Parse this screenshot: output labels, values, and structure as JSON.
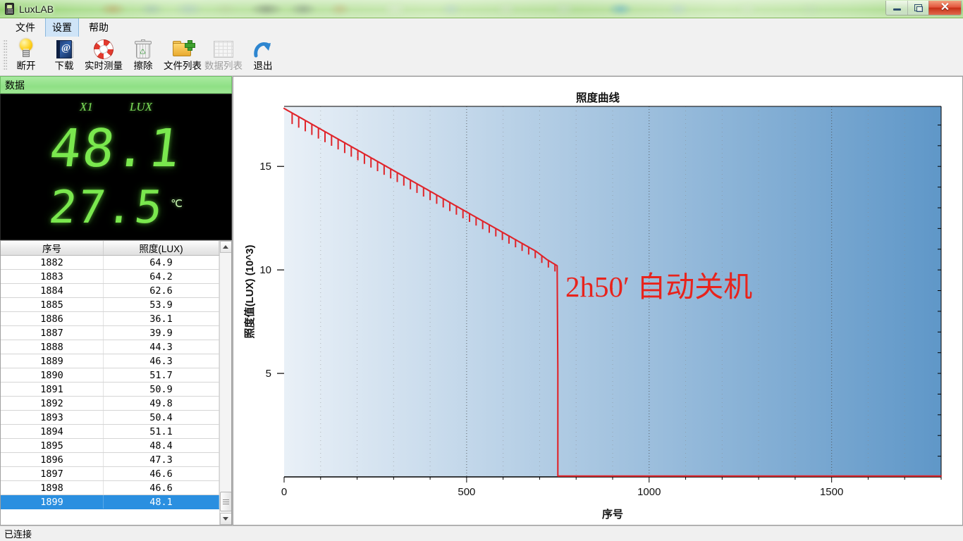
{
  "window": {
    "title": "LuxLAB",
    "app_icon": "device-icon",
    "buttons": {
      "minimize": "minimize-icon",
      "restore": "restore-icon",
      "close": "✕"
    }
  },
  "menu": {
    "items": [
      {
        "label": "文件",
        "active": false
      },
      {
        "label": "设置",
        "active": true
      },
      {
        "label": "帮助",
        "active": false
      }
    ]
  },
  "toolbar": {
    "buttons": [
      {
        "label": "断开",
        "icon": "lightbulb-icon",
        "disabled": false
      },
      {
        "label": "下载",
        "icon": "book-at-icon",
        "disabled": false
      },
      {
        "label": "实时测量",
        "icon": "lifebuoy-icon",
        "disabled": false
      },
      {
        "label": "擦除",
        "icon": "trash-icon",
        "disabled": false
      },
      {
        "label": "文件列表",
        "icon": "folder-plus-icon",
        "disabled": false
      },
      {
        "label": "数据列表",
        "icon": "table-grid-icon",
        "disabled": true
      },
      {
        "label": "退出",
        "icon": "exit-arrow-icon",
        "disabled": false
      }
    ]
  },
  "data_panel": {
    "header": "数据",
    "display": {
      "range_label": "X1",
      "unit_label": "LUX",
      "lux_value": "48.1",
      "temp_value": "27.5",
      "temp_unit": "℃"
    },
    "table": {
      "columns": [
        "序号",
        "照度(LUX)"
      ],
      "rows": [
        {
          "index": "1882",
          "lux": "64.9",
          "selected": false
        },
        {
          "index": "1883",
          "lux": "64.2",
          "selected": false
        },
        {
          "index": "1884",
          "lux": "62.6",
          "selected": false
        },
        {
          "index": "1885",
          "lux": "53.9",
          "selected": false
        },
        {
          "index": "1886",
          "lux": "36.1",
          "selected": false
        },
        {
          "index": "1887",
          "lux": "39.9",
          "selected": false
        },
        {
          "index": "1888",
          "lux": "44.3",
          "selected": false
        },
        {
          "index": "1889",
          "lux": "46.3",
          "selected": false
        },
        {
          "index": "1890",
          "lux": "51.7",
          "selected": false
        },
        {
          "index": "1891",
          "lux": "50.9",
          "selected": false
        },
        {
          "index": "1892",
          "lux": "49.8",
          "selected": false
        },
        {
          "index": "1893",
          "lux": "50.4",
          "selected": false
        },
        {
          "index": "1894",
          "lux": "51.1",
          "selected": false
        },
        {
          "index": "1895",
          "lux": "48.4",
          "selected": false
        },
        {
          "index": "1896",
          "lux": "47.3",
          "selected": false
        },
        {
          "index": "1897",
          "lux": "46.6",
          "selected": false
        },
        {
          "index": "1898",
          "lux": "46.6",
          "selected": false
        },
        {
          "index": "1899",
          "lux": "48.1",
          "selected": true
        }
      ]
    },
    "scrollbar": {
      "up": "scroll-up-icon",
      "down": "scroll-down-icon"
    }
  },
  "status": {
    "text": "已连接"
  },
  "chart_data": {
    "type": "line",
    "title": "照度曲线",
    "xlabel": "序号",
    "ylabel": "照度值(LUX) (10^3)",
    "xlim": [
      0,
      1800
    ],
    "ylim": [
      0,
      17.9
    ],
    "xticks": [
      0,
      500,
      1000,
      1500
    ],
    "xtick_labels": [
      "0",
      "500",
      "1000",
      "1500"
    ],
    "yticks": [
      5,
      10,
      15
    ],
    "ytick_labels": [
      "5",
      "10",
      "15"
    ],
    "grid": true,
    "grid_style": "dotted-vertical",
    "line_color": "#e0242a",
    "plot_gradient": [
      "#e9f0f7",
      "#5f97c8"
    ],
    "annotations": [
      {
        "text": "2h50′ 自动关机",
        "x": 790,
        "y": 9.4,
        "color": "#e8231c"
      }
    ],
    "series": [
      {
        "name": "照度",
        "comment": "Steady decay from ~17.8 to ~10.2 over x=0..750 with periodic downward sawtooth dips, then abrupt drop to ~0 (auto shutdown) held flat to x=1800",
        "x": [
          0,
          30,
          60,
          90,
          120,
          150,
          180,
          210,
          240,
          270,
          300,
          330,
          360,
          390,
          420,
          450,
          480,
          510,
          540,
          570,
          600,
          630,
          660,
          690,
          720,
          748,
          752,
          900,
          1100,
          1300,
          1500,
          1700,
          1800
        ],
        "values": [
          17.8,
          17.5,
          17.2,
          16.9,
          16.6,
          16.3,
          16.0,
          15.7,
          15.4,
          15.1,
          14.8,
          14.5,
          14.2,
          13.9,
          13.6,
          13.3,
          13.0,
          12.7,
          12.4,
          12.1,
          11.8,
          11.5,
          11.2,
          10.9,
          10.5,
          10.2,
          0.05,
          0.05,
          0.05,
          0.05,
          0.05,
          0.05,
          0.05
        ],
        "dip_depth": 0.45,
        "dip_period": 18
      }
    ]
  }
}
